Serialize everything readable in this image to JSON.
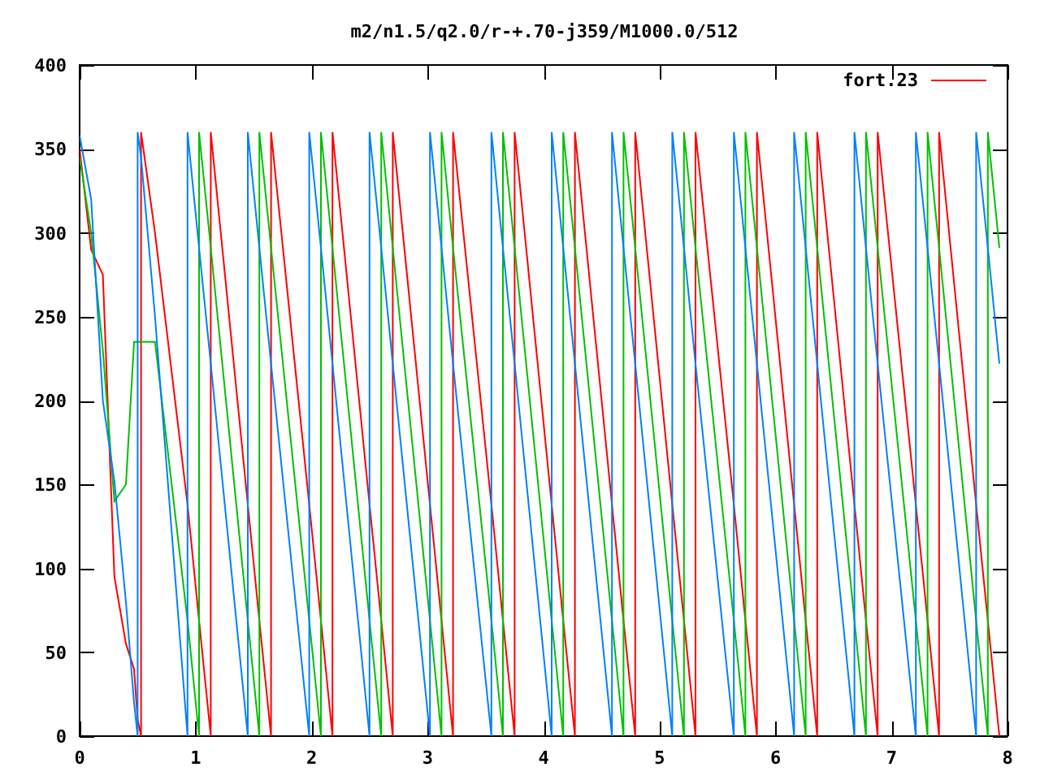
{
  "chart_data": {
    "type": "line",
    "title": "m2/n1.5/q2.0/r-+.70-j359/M1000.0/512",
    "x": [
      0,
      0.1,
      0.2,
      0.3,
      0.4,
      0.47,
      0.5,
      0.5,
      0.53,
      0.53,
      0.65,
      0.93,
      0.93,
      1.03,
      1.03,
      1.13,
      1.13,
      1.45,
      1.45,
      1.55,
      1.55,
      1.65,
      1.65,
      1.98,
      1.98,
      2.08,
      2.08,
      2.18,
      2.18,
      2.5,
      2.5,
      2.6,
      2.6,
      2.7,
      2.7,
      3.02,
      3.02,
      3.12,
      3.12,
      3.22,
      3.22,
      3.55,
      3.55,
      3.65,
      3.65,
      3.75,
      3.75,
      4.07,
      4.07,
      4.17,
      4.17,
      4.27,
      4.27,
      4.59,
      4.59,
      4.69,
      4.69,
      4.79,
      4.79,
      5.11,
      5.11,
      5.21,
      5.21,
      5.31,
      5.31,
      5.64,
      5.64,
      5.74,
      5.74,
      5.84,
      5.84,
      6.16,
      6.16,
      6.26,
      6.26,
      6.36,
      6.36,
      6.68,
      6.68,
      6.78,
      6.78,
      6.88,
      6.88,
      7.21,
      7.21,
      7.31,
      7.31,
      7.41,
      7.41,
      7.73,
      7.73,
      7.83,
      7.83,
      7.93
    ],
    "series": [
      {
        "name": "fort.23",
        "color": "#ff0000",
        "values": [
          350,
          290,
          275,
          95,
          55,
          40,
          10,
          10,
          0,
          360,
          300,
          138,
          138,
          69,
          69,
          0,
          360,
          138,
          138,
          69,
          69,
          0,
          360,
          138,
          138,
          69,
          69,
          0,
          360,
          138,
          138,
          69,
          69,
          0,
          360,
          138,
          138,
          69,
          69,
          0,
          360,
          138,
          138,
          69,
          69,
          0,
          360,
          138,
          138,
          69,
          69,
          0,
          360,
          138,
          138,
          69,
          69,
          0,
          360,
          138,
          138,
          69,
          69,
          0,
          360,
          138,
          138,
          69,
          69,
          0,
          360,
          138,
          138,
          69,
          69,
          0,
          360,
          138,
          138,
          69,
          69,
          0,
          360,
          138,
          138,
          69,
          69,
          0,
          360,
          138,
          138,
          69,
          69,
          0
        ]
      },
      {
        "color": "#00c000",
        "values": [
          345,
          300,
          230,
          140,
          150,
          235,
          235,
          235,
          235,
          235,
          235,
          69,
          69,
          0,
          360,
          291,
          291,
          69,
          69,
          0,
          360,
          291,
          291,
          69,
          69,
          0,
          360,
          291,
          291,
          69,
          69,
          0,
          360,
          291,
          291,
          69,
          69,
          0,
          360,
          291,
          291,
          69,
          69,
          0,
          360,
          291,
          291,
          69,
          69,
          0,
          360,
          291,
          291,
          69,
          69,
          0,
          360,
          291,
          291,
          69,
          69,
          0,
          360,
          291,
          291,
          69,
          69,
          0,
          360,
          291,
          291,
          69,
          69,
          0,
          360,
          291,
          291,
          69,
          69,
          0,
          360,
          291,
          291,
          69,
          69,
          0,
          360,
          291,
          291,
          69,
          69,
          0,
          360,
          291
        ]
      },
      {
        "color": "#0080ff",
        "values": [
          358,
          320,
          200,
          152,
          80,
          20,
          0,
          360,
          345,
          345,
          250,
          0,
          360,
          291,
          291,
          222,
          222,
          0,
          360,
          291,
          291,
          222,
          222,
          0,
          360,
          291,
          291,
          222,
          222,
          0,
          360,
          291,
          291,
          222,
          222,
          0,
          360,
          291,
          291,
          222,
          222,
          0,
          360,
          291,
          291,
          222,
          222,
          0,
          360,
          291,
          291,
          222,
          222,
          0,
          360,
          291,
          291,
          222,
          222,
          0,
          360,
          291,
          291,
          222,
          222,
          0,
          360,
          291,
          291,
          222,
          222,
          0,
          360,
          291,
          291,
          222,
          222,
          0,
          360,
          291,
          291,
          222,
          222,
          0,
          360,
          291,
          291,
          222,
          222,
          0,
          360,
          291,
          291,
          222
        ]
      }
    ],
    "xlim": [
      0,
      8
    ],
    "ylim": [
      0,
      400
    ],
    "xticks": [
      0,
      1,
      2,
      3,
      4,
      5,
      6,
      7,
      8
    ],
    "yticks": [
      0,
      50,
      100,
      150,
      200,
      250,
      300,
      350,
      400
    ]
  }
}
